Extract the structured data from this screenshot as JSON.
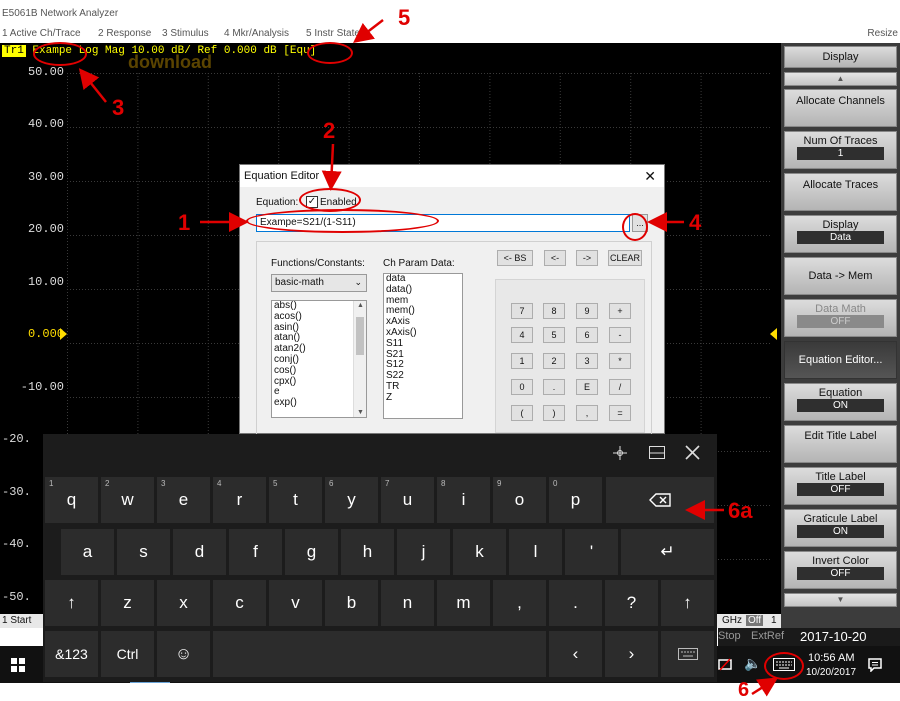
{
  "app": {
    "title": "E5061B Network Analyzer",
    "resize": "Resize"
  },
  "menu": [
    "1 Active Ch/Trace",
    "2 Response",
    "3 Stimulus",
    "4 Mkr/Analysis",
    "5 Instr State"
  ],
  "plot": {
    "trace_tag": "Tr1",
    "trace_header": "Exampe Log Mag 10.00 dB/ Ref 0.000 dB [Equ]",
    "watermark": "download",
    "y_ticks": [
      "50.00",
      "40.00",
      "30.00",
      "20.00",
      "10.00",
      "0.000",
      "-10.00",
      "-20.",
      "-30.",
      "-40.",
      "-50."
    ],
    "reference_tick": "0.000",
    "grid_color": "#3a3a3a",
    "axis_label_color": "#dddddd"
  },
  "status": {
    "start": "1 Start",
    "ghz": "GHz",
    "off": "Off",
    "one": "1"
  },
  "datetime_bar": {
    "stop": "Stop",
    "extref": "ExtRef",
    "datetime": "2017-10-20 10:56"
  },
  "softkeys": {
    "header": "Display",
    "items": [
      {
        "label": "Allocate Channels",
        "value": ""
      },
      {
        "label": "Num Of Traces",
        "value": "1"
      },
      {
        "label": "Allocate Traces",
        "value": ""
      },
      {
        "label": "Display",
        "value": "Data"
      },
      {
        "label": "Data -> Mem",
        "value": ""
      },
      {
        "label": "Data Math",
        "value": "OFF"
      },
      {
        "label": "Equation Editor...",
        "value": ""
      },
      {
        "label": "Equation",
        "value": "ON"
      },
      {
        "label": "Edit Title Label",
        "value": ""
      },
      {
        "label": "Title Label",
        "value": "OFF"
      },
      {
        "label": "Graticule Label",
        "value": "ON"
      },
      {
        "label": "Invert Color",
        "value": "OFF"
      }
    ]
  },
  "dialog": {
    "title": "Equation Editor",
    "close": "✕",
    "equation_label": "Equation:",
    "enabled_label": "Enabled",
    "enabled_check": "✓",
    "equation_value": "Exampe=S21/(1-S11)",
    "browse": "...",
    "functions_label": "Functions/Constants:",
    "function_category": "basic-math",
    "functions": [
      "abs()",
      "acos()",
      "asin()",
      "atan()",
      "atan2()",
      "conj()",
      "cos()",
      "cpx()",
      "e",
      "exp()"
    ],
    "params_label": "Ch Param Data:",
    "params": [
      "data",
      "data()",
      "mem",
      "mem()",
      "xAxis",
      "xAxis()",
      "S11",
      "S21",
      "S12",
      "S22",
      "TR",
      "Z"
    ],
    "edit_buttons": [
      "<- BS",
      "<-",
      "->",
      "CLEAR"
    ],
    "keypad": [
      [
        "7",
        "8",
        "9",
        "+"
      ],
      [
        "4",
        "5",
        "6",
        "-"
      ],
      [
        "1",
        "2",
        "3",
        "*"
      ],
      [
        "0",
        ".",
        "E",
        "/"
      ],
      [
        "(",
        ")",
        ",",
        "="
      ]
    ]
  },
  "keyboard": {
    "row1": [
      [
        "q",
        "1"
      ],
      [
        "w",
        "2"
      ],
      [
        "e",
        "3"
      ],
      [
        "r",
        "4"
      ],
      [
        "t",
        "5"
      ],
      [
        "y",
        "6"
      ],
      [
        "u",
        "7"
      ],
      [
        "i",
        "8"
      ],
      [
        "o",
        "9"
      ],
      [
        "p",
        "0"
      ]
    ],
    "row2": [
      "a",
      "s",
      "d",
      "f",
      "g",
      "h",
      "j",
      "k",
      "l",
      "'"
    ],
    "row3": [
      "z",
      "x",
      "c",
      "v",
      "b",
      "n",
      "m",
      ",",
      ".",
      "?"
    ],
    "special": {
      "num": "&123",
      "ctrl": "Ctrl"
    }
  },
  "tray": {
    "time": "10:56 AM",
    "date": "10/20/2017"
  },
  "annotations": [
    "1",
    "2",
    "3",
    "4",
    "5",
    "6",
    "6a"
  ]
}
